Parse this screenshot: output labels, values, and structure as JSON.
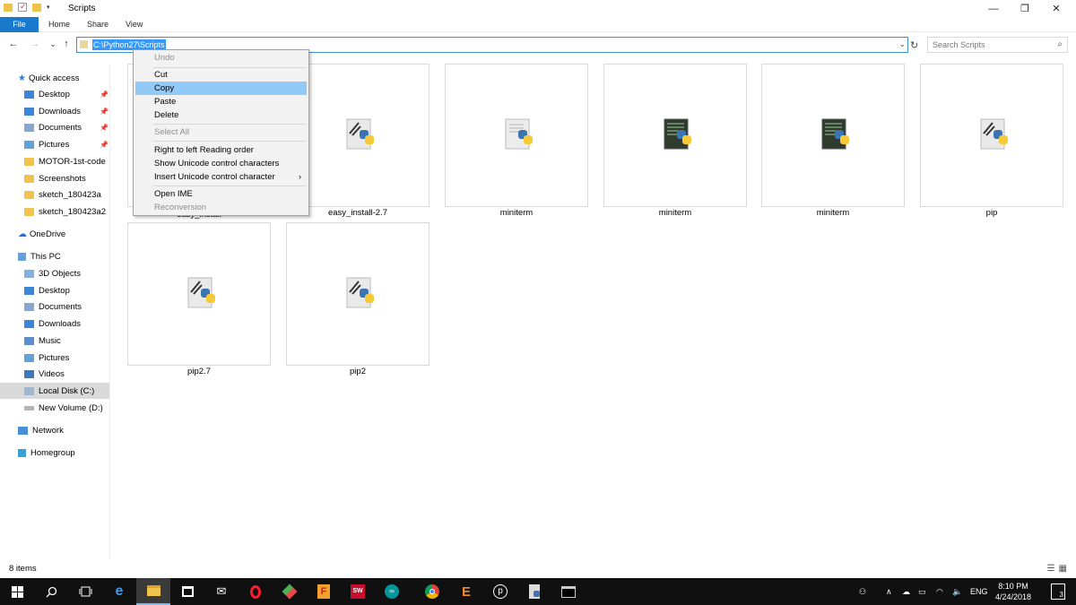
{
  "window": {
    "title": "Scripts",
    "minimize": "—",
    "maximize": "❐",
    "close": "✕"
  },
  "ribbon": {
    "tabs": [
      "File",
      "Home",
      "Share",
      "View"
    ]
  },
  "navigation": {
    "back": "←",
    "forward": "→",
    "recent": "⌄",
    "up": "↑",
    "address": "C:\\Python27\\Scripts",
    "refresh": "↻",
    "search_placeholder": "Search Scripts"
  },
  "sidebar": {
    "quick_access": "Quick access",
    "quick_items": [
      "Desktop",
      "Downloads",
      "Documents",
      "Pictures",
      "MOTOR-1st-code",
      "Screenshots",
      "sketch_180423a",
      "sketch_180423a2"
    ],
    "onedrive": "OneDrive",
    "this_pc": "This PC",
    "pc_items": [
      "3D Objects",
      "Desktop",
      "Documents",
      "Downloads",
      "Music",
      "Pictures",
      "Videos",
      "Local Disk (C:)",
      "New Volume (D:)"
    ],
    "network": "Network",
    "homegroup": "Homegroup"
  },
  "files": [
    {
      "name": "easy_install",
      "icon": "python-script-icon"
    },
    {
      "name": "easy_install-2.7",
      "icon": "python-script-icon"
    },
    {
      "name": "miniterm",
      "icon": "python-file-icon"
    },
    {
      "name": "miniterm",
      "icon": "python-compiled-icon"
    },
    {
      "name": "miniterm",
      "icon": "python-compiled-icon"
    },
    {
      "name": "pip",
      "icon": "python-script-icon"
    },
    {
      "name": "pip2.7",
      "icon": "python-script-icon"
    },
    {
      "name": "pip2",
      "icon": "python-script-icon"
    }
  ],
  "context_menu": {
    "undo": "Undo",
    "cut": "Cut",
    "copy": "Copy",
    "paste": "Paste",
    "delete": "Delete",
    "select_all": "Select All",
    "rtl": "Right to left Reading order",
    "show_unicode": "Show Unicode control characters",
    "insert_unicode": "Insert Unicode control character",
    "open_ime": "Open IME",
    "reconversion": "Reconversion",
    "submenu_arrow": "›"
  },
  "status": {
    "count": "8 items"
  },
  "taskbar": {
    "language": "ENG",
    "time": "8:10 PM",
    "date": "4/24/2018",
    "notifications": "3"
  },
  "colors": {
    "accent": "#1979ca",
    "selection": "#3399ff",
    "menu_highlight": "#91c9f7",
    "folder": "#f0c44c",
    "taskbar": "#101010"
  }
}
